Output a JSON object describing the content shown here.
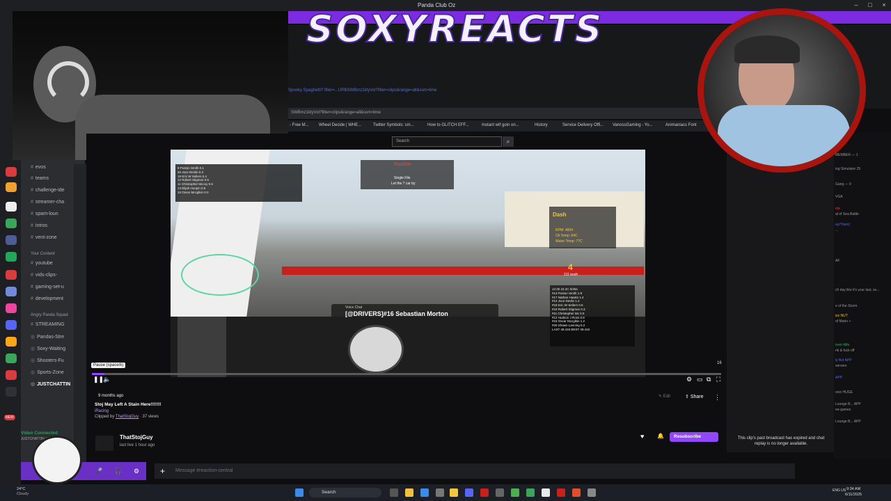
{
  "window": {
    "title": "Panda Club Oz"
  },
  "brand": {
    "title": "SOXYREACTS"
  },
  "browser": {
    "url": "SWBmz1ktyVol?filter=clips&range=all&sort=time",
    "url_ghost": "Spooky Spaghetti? filter=...URBSWBmz1ktyVol?filter=clips&range=all&sort=time",
    "search_placeholder": "Search",
    "bookmarks": [
      "- Free M...",
      "Wheel Decide | WHE...",
      "Twitter Symbols: sm...",
      "How to GLITCH EFF...",
      "Instant wtf goin on...",
      "History",
      "Service Delivery Offi...",
      "VanossGaming - Yo...",
      "Animaniacs Font"
    ]
  },
  "discord": {
    "categories": {
      "your_content": "Your Content",
      "angry_panda": "Angry Panda Squad"
    },
    "channels": [
      "evos",
      "teams",
      "challenge-ide",
      "streamer-cha",
      "spam-loun",
      "intros",
      "vent-zone",
      "youtube",
      "vids-clips-",
      "gaming-set-u",
      "development",
      "STREAMING",
      "Pandas-Stre",
      "Soxy-Waiting",
      "Shooters-Fu",
      "Sports-Zone",
      "JUSTCHATTIN"
    ],
    "voice_connected": "Video Connected",
    "voice_sub": "JUSTCHATTIN / Panda...",
    "message_placeholder": "Message #reaction-central",
    "new_badge": "NEW"
  },
  "game": {
    "flag_title": "Pauline",
    "flag_sub": "Single File",
    "flag_sub2": "Let the 7 car by",
    "dash_label": "Dash",
    "dash_lines": [
      "RPM: 4894",
      "Oil Temp: 84C",
      "Water Temp: 77C"
    ],
    "gear": "4",
    "speed": "211 km/h",
    "voice_label": "Voice Chat",
    "voice_speaker": "[@DRIVERS]#16 Sebastian Morton",
    "standings_top": [
      "9   Poston Smith      0.1",
      "20  Joce Devlin       0.3",
      "19  Eric W Sellers    0.4",
      "12  Robert Stigmon    0.5",
      "11  Christopher Mccoy 0.6",
      "13  Elijah Hoopin     0.8",
      "10  Oscar Mccglkin    0.0"
    ],
    "standings_bottom": [
      "12:30  22.2C  0/25s",
      "#13 Poston Smith    1.9",
      "#17 Nathan Hawks    1.4",
      "#14 Joce Devlin     1.2",
      "#18 Eric W Sellers  0.6",
      "#19 Robert Stigmon  0.3",
      "#11 Christopher Mc  0.0",
      "#12 Hudson J Ross   0.8",
      "#15 Oscar Mccglkin  1.2",
      "#20 Shawn Lanning   0.2",
      "LAST 49.416  BEST 49.416"
    ]
  },
  "player": {
    "pause_tip": "Pause (space/k)",
    "progress": 0.02,
    "time_right": "16"
  },
  "clip": {
    "age": "9 months ago",
    "title": "Stoj May Left A Stain Here!!!!!!!",
    "game": "iRacing",
    "clipped_prefix": "Clipped by",
    "clipped_by": "ThatStojGuy",
    "views": "37 views",
    "channel_name": "ThatStojGuy",
    "channel_live": "last live 1 hour ago",
    "edit_label": "Edit",
    "share_label": "Share",
    "subscribe_label": "Resubscribe"
  },
  "chat": {
    "broadcast_expired": "This clip's past broadcast has expired and chat replay is no longer available.",
    "lines": [
      "MEMBER — 1",
      "ing Simulator 25",
      "Gang — 9",
      "VGA",
      "rck",
      "al of Sea Battle",
      "ey/Them)",
      "...",
      "AF",
      "ch day like it's your last, so...",
      "e of the Storm",
      "izz NUT",
      "of Mario +",
      "ireet 4life",
      "nk & fuck off",
      "ly Bot APP",
      "servers",
      "APP",
      "onic HUGE",
      "Lounge B... APP",
      "ee-games",
      "Lounge B... APP"
    ]
  },
  "taskbar": {
    "search": "Search",
    "weather_temp": "24°C",
    "weather_cond": "Cloudy",
    "lang": "ENG US",
    "time": "9:34 AM",
    "date": "6/11/2025"
  }
}
